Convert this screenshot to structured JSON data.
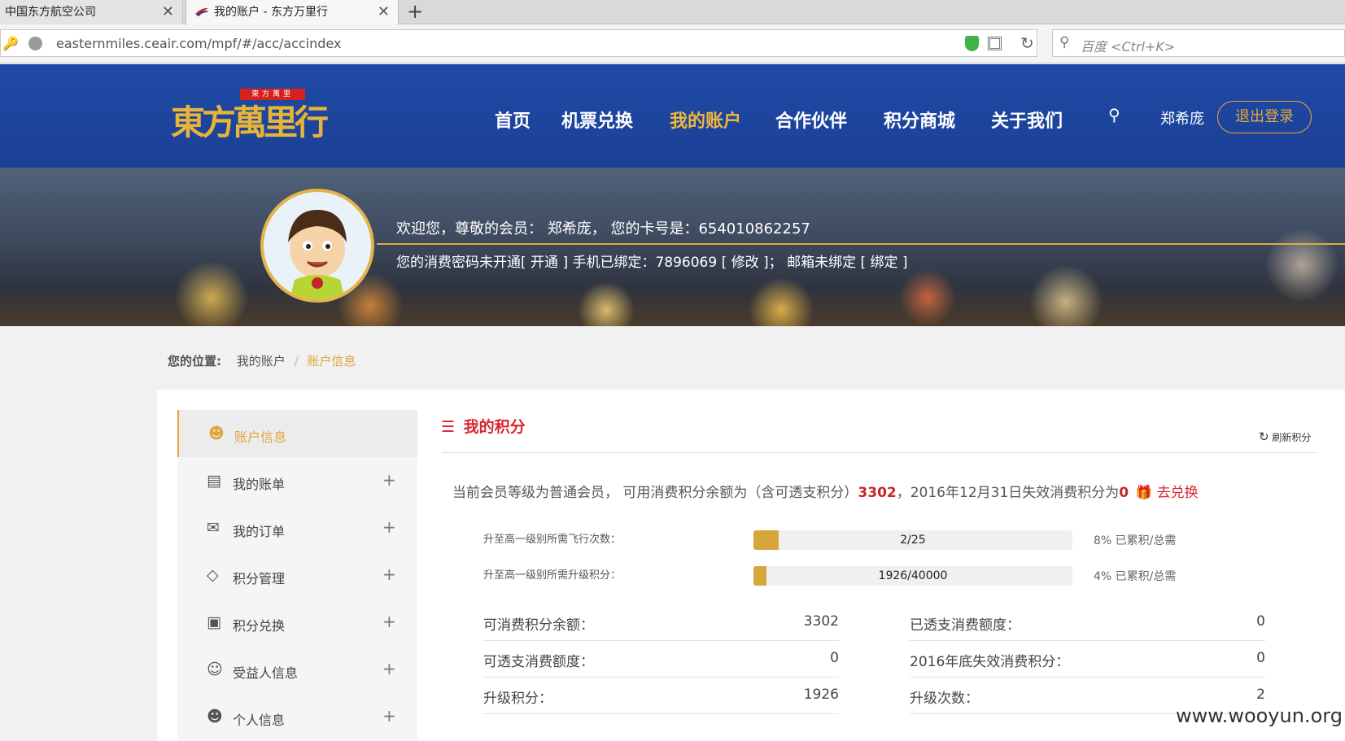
{
  "browser": {
    "tabs": [
      {
        "title": "中国东方航空公司"
      },
      {
        "title": "我的账户 - 东方万里行"
      }
    ],
    "url": "easternmiles.ceair.com/mpf/#/acc/accindex",
    "search_placeholder": "百度 <Ctrl+K>"
  },
  "header": {
    "logo_text": "東方萬里行",
    "logo_tag": "東方萬里",
    "nav": [
      "首页",
      "机票兑换",
      "我的账户",
      "合作伙伴",
      "积分商城",
      "关于我们"
    ],
    "active_nav": "我的账户",
    "username": "郑希庞",
    "logout_label": "退出登录"
  },
  "banner": {
    "welcome": "欢迎您，尊敬的会员： 郑希庞， 您的卡号是：654010862257",
    "status": "您的消费密码未开通[ 开通 ] 手机已绑定：7896069 [ 修改 ]； 邮箱未绑定 [ 绑定 ]"
  },
  "breadcrumb": {
    "label": "您的位置:",
    "items": [
      "我的账户",
      "账户信息"
    ]
  },
  "sidebar": {
    "items": [
      {
        "label": "账户信息",
        "icon": "user-icon",
        "active": true
      },
      {
        "label": "我的账单",
        "icon": "wallet-icon"
      },
      {
        "label": "我的订单",
        "icon": "envelope-open-icon"
      },
      {
        "label": "积分管理",
        "icon": "diamond-icon"
      },
      {
        "label": "积分兑换",
        "icon": "inbox-icon"
      },
      {
        "label": "受益人信息",
        "icon": "users-icon"
      },
      {
        "label": "个人信息",
        "icon": "user-icon"
      }
    ],
    "plus": "+"
  },
  "points": {
    "title": "我的积分",
    "refresh_label": "刷新积分",
    "summary": {
      "prefix": "当前会员等级为普通会员， 可用消费积分余额为（含可透支积分）",
      "balance": "3302",
      "mid": "，2016年12月31日失效消费积分为",
      "expiring": "0",
      "redeem": "去兑换"
    },
    "progress": [
      {
        "label": "升至高一级别所需飞行次数：",
        "text": "2/25",
        "fraction": 0.08,
        "pct": "8% 已累积/总需"
      },
      {
        "label": "升至高一级别所需升级积分：",
        "text": "1926/40000",
        "fraction": 0.04,
        "pct": "4% 已累积/总需"
      }
    ],
    "stats_left": [
      {
        "key": "可消费积分余额：",
        "value": "3302"
      },
      {
        "key": "可透支消费额度：",
        "value": "0"
      },
      {
        "key": "升级积分：",
        "value": "1926"
      }
    ],
    "stats_right": [
      {
        "key": "已透支消费额度：",
        "value": "0"
      },
      {
        "key": "2016年底失效消费积分：",
        "value": "0"
      },
      {
        "key": "升级次数：",
        "value": "2"
      }
    ]
  },
  "watermark": "www.wooyun.org",
  "colors": {
    "header_blue": "#1f4ba6",
    "accent_gold": "#e1a540",
    "accent_red": "#d7282f"
  }
}
